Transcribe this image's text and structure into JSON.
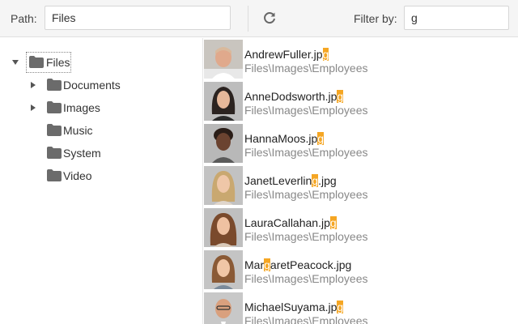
{
  "toolbar": {
    "path_label": "Path:",
    "path_value": "Files",
    "filter_label": "Filter by:",
    "filter_value": "g",
    "refresh_icon": "refresh-icon"
  },
  "tree": {
    "root": {
      "label": "Files",
      "expanded": true
    },
    "children": [
      {
        "label": "Documents",
        "has_children": true
      },
      {
        "label": "Images",
        "has_children": true
      },
      {
        "label": "Music",
        "has_children": false
      },
      {
        "label": "System",
        "has_children": false
      },
      {
        "label": "Video",
        "has_children": false
      }
    ]
  },
  "files": [
    {
      "pre": "AndrewFuller.jp",
      "match": "g",
      "post": "",
      "path": "Files\\Images\\Employees"
    },
    {
      "pre": "AnneDodsworth.jp",
      "match": "g",
      "post": "",
      "path": "Files\\Images\\Employees"
    },
    {
      "pre": "HannaMoos.jp",
      "match": "g",
      "post": "",
      "path": "Files\\Images\\Employees"
    },
    {
      "pre": "JanetLeverlin",
      "match": "g",
      "post": ".jpg",
      "path": "Files\\Images\\Employees"
    },
    {
      "pre": "LauraCallahan.jp",
      "match": "g",
      "post": "",
      "path": "Files\\Images\\Employees"
    },
    {
      "pre": "Mar",
      "match": "g",
      "post": "aretPeacock.jpg",
      "path": "Files\\Images\\Employees"
    },
    {
      "pre": "MichaelSuyama.jp",
      "match": "g",
      "post": "",
      "path": "Files\\Images\\Employees"
    }
  ],
  "colors": {
    "highlight": "#f5a623",
    "folder": "#6b6b6b",
    "toolbar_bg": "#f5f5f5"
  }
}
